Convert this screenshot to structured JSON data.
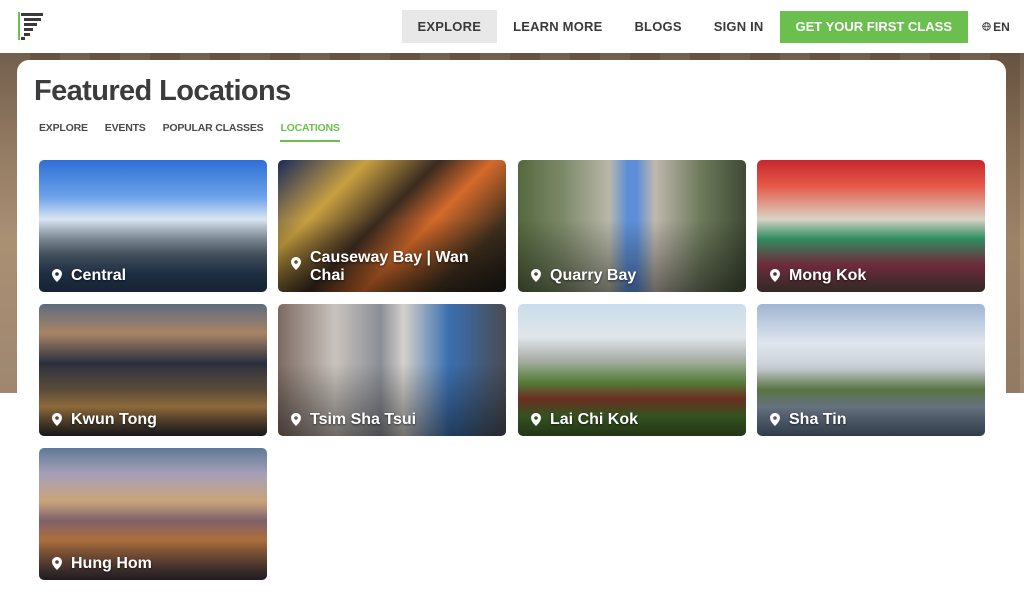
{
  "brand": {
    "accent": "#6bbf4e",
    "logo_icon": "bars-logo-icon"
  },
  "nav": {
    "items": [
      {
        "label": "EXPLORE",
        "active": true
      },
      {
        "label": "LEARN MORE",
        "active": false
      },
      {
        "label": "BLOGS",
        "active": false
      },
      {
        "label": "SIGN IN",
        "active": false
      }
    ],
    "cta_label": "GET YOUR FIRST CLASS",
    "language": "EN",
    "language_icon": "globe-icon"
  },
  "page": {
    "title": "Featured Locations",
    "subnav": [
      {
        "label": "EXPLORE",
        "active": false
      },
      {
        "label": "EVENTS",
        "active": false
      },
      {
        "label": "POPULAR CLASSES",
        "active": false
      },
      {
        "label": "LOCATIONS",
        "active": true
      }
    ]
  },
  "locations": [
    {
      "name": "Central",
      "icon": "map-pin-icon"
    },
    {
      "name": "Causeway Bay | Wan Chai",
      "icon": "map-pin-icon"
    },
    {
      "name": "Quarry Bay",
      "icon": "map-pin-icon"
    },
    {
      "name": "Mong Kok",
      "icon": "map-pin-icon"
    },
    {
      "name": "Kwun Tong",
      "icon": "map-pin-icon"
    },
    {
      "name": "Tsim Sha Tsui",
      "icon": "map-pin-icon"
    },
    {
      "name": "Lai Chi Kok",
      "icon": "map-pin-icon"
    },
    {
      "name": "Sha Tin",
      "icon": "map-pin-icon"
    },
    {
      "name": "Hung Hom",
      "icon": "map-pin-icon"
    }
  ]
}
